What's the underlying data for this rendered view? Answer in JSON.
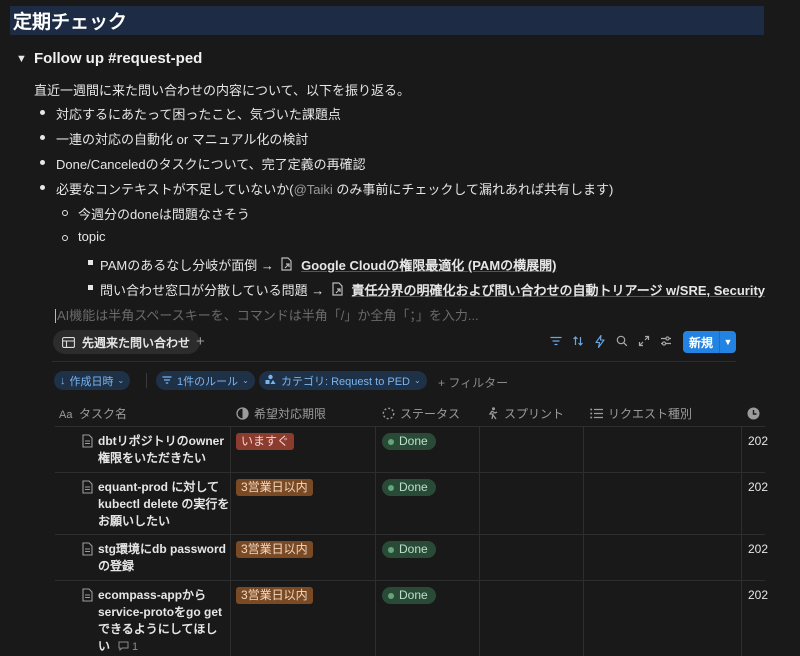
{
  "page": {
    "title": "定期チェック"
  },
  "toggle": {
    "title": "Follow up #request-ped",
    "intro": "直近一週間に来た問い合わせの内容について、以下を振り返る。",
    "bullets": [
      "対応するにあたって困ったこと、気づいた課題点",
      "一連の対応の自動化 or マニュアル化の検討",
      "Done/Canceledのタスクについて、完了定義の再確認"
    ],
    "bullet4_prefix": "必要なコンテキストが不足していないか(",
    "bullet4_mention": "@Taiki",
    "bullet4_suffix": " のみ事前にチェックして漏れあれば共有します)",
    "sub1": "今週分のdoneは問題なさそう",
    "sub2": "topic",
    "item1_prefix": "PAMのあるなし分岐が面倒 →",
    "item1_link": "Google Cloudの権限最適化 (PAMの横展開)",
    "item2_prefix": "問い合わせ窓口が分散している問題 →",
    "item2_link": "責任分界の明確化および問い合わせの自動トリアージ w/SRE, Security",
    "placeholder": "AI機能は半角スペースキーを、コマンドは半角「/」か全角「；」を入力..."
  },
  "database": {
    "view_tab": "先週来た問い合わせ",
    "new_button": "新規",
    "add_view": "+",
    "filters": {
      "sort": "作成日時",
      "rule": "1件のルール",
      "category": "カテゴリ: Request to PED",
      "add_filter": "+ フィルター"
    },
    "columns": [
      "タスク名",
      "希望対応期限",
      "ステータス",
      "スプリント",
      "リクエスト種別",
      ""
    ],
    "rows": [
      {
        "name": [
          "dbtリポジトリのowner",
          "権限をいただきたい"
        ],
        "deadline": "いますぐ",
        "status": "Done",
        "created": "202"
      },
      {
        "name": [
          "equant-prod に対して",
          "kubectl delete の実行を",
          "お願いしたい"
        ],
        "deadline": "3営業日以内",
        "status": "Done",
        "created": "202"
      },
      {
        "name": [
          "stg環境にdb password",
          "の登録"
        ],
        "deadline": "3営業日以内",
        "status": "Done",
        "created": "202"
      },
      {
        "name": [
          "ecompass-appから",
          "service-protoをgo get",
          "できるようにしてほし",
          "い"
        ],
        "deadline": "3営業日以内",
        "status": "Done",
        "created": "202",
        "comments": "1"
      }
    ]
  },
  "colors": {
    "background": "#191919",
    "title_bar": "#1d2b44",
    "accent": "#2383e2",
    "status_done": "#62a67a",
    "deadline_urgent": "#8c3b2f",
    "deadline_normal": "#7a4a25"
  }
}
